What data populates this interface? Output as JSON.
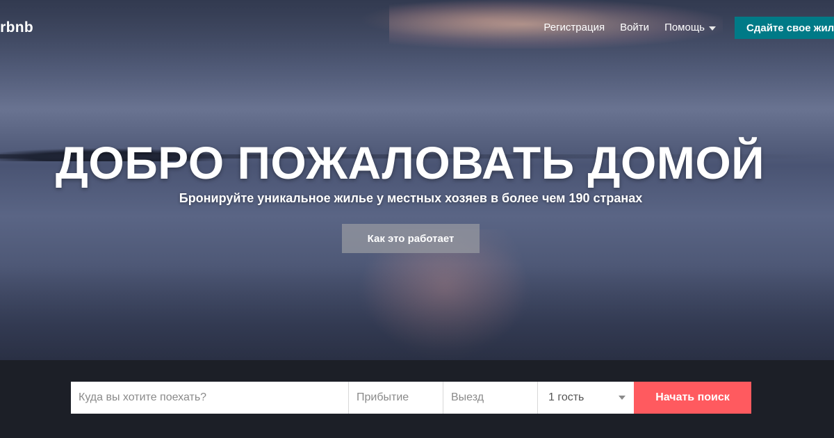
{
  "header": {
    "logo_text": "irbnb",
    "nav": {
      "signup": "Регистрация",
      "login": "Войти",
      "help": "Помощь"
    },
    "host_button": "Сдайте свое жилье"
  },
  "hero": {
    "headline": "ДОБРО ПОЖАЛОВАТЬ ДОМОЙ",
    "subline": "Бронируйте уникальное жилье у местных хозяев в более чем 190 странах",
    "how_it_works": "Как это работает"
  },
  "search": {
    "where_placeholder": "Куда вы хотите поехать?",
    "checkin_placeholder": "Прибытие",
    "checkout_placeholder": "Выезд",
    "guests_value": "1 гость",
    "submit_label": "Начать поиск"
  },
  "colors": {
    "host_button": "#007a87",
    "search_button": "#ff5a5f",
    "search_bar_bg": "#1c1f27"
  },
  "icons": {
    "help_dropdown": "chevron-down-icon",
    "guests_dropdown": "chevron-down-icon"
  }
}
